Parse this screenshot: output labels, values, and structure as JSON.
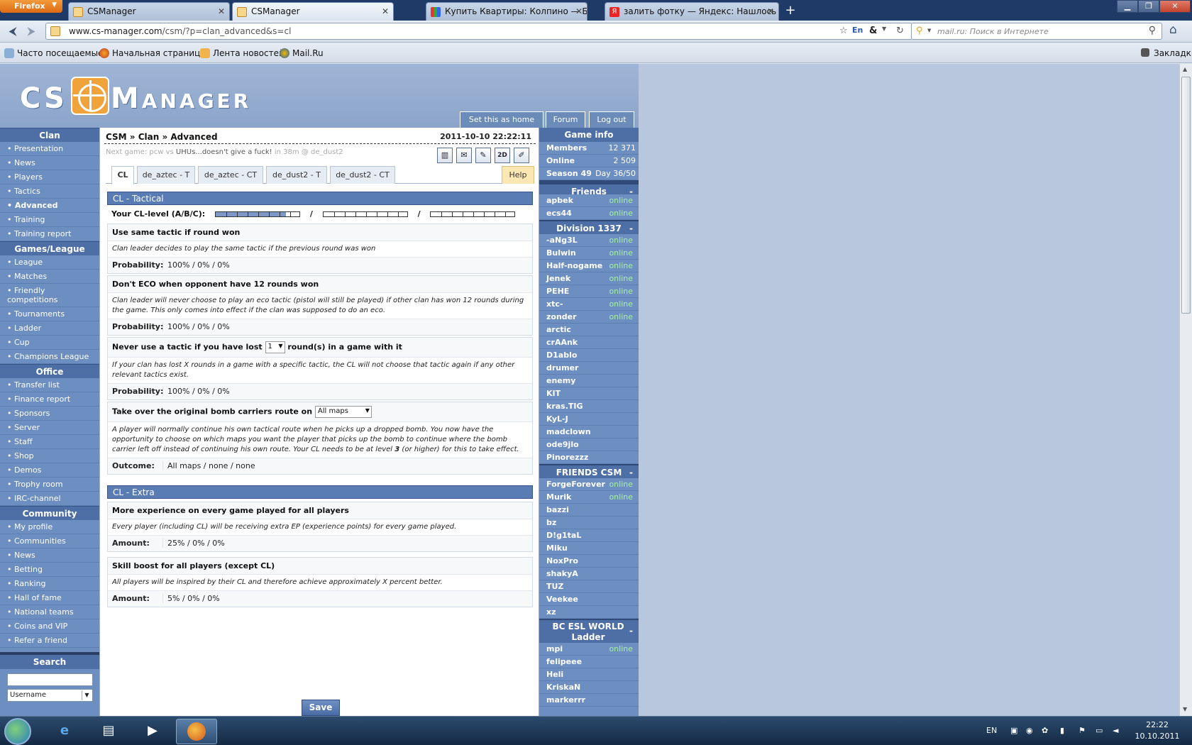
{
  "browser": {
    "menu_label": "Firefox",
    "tabs": [
      {
        "title": "CSManager"
      },
      {
        "title": "CSManager"
      },
      {
        "title": "Купить Квартиры: Колпино — Бесп..."
      },
      {
        "title": "залить фотку — Яндекс: Нашлось 5 ..."
      }
    ],
    "url_host": "www.cs-manager.com",
    "url_path": "/csm/?p=clan_advanced&s=cl",
    "search_placeholder": "mail.ru: Поиск в Интернете",
    "bookmarks": [
      "Часто посещаемые",
      "Начальная страница",
      "Лента новостей",
      "Mail.Ru"
    ],
    "bookmarks_menu": "Закладки"
  },
  "header": {
    "logo_left": "CS",
    "logo_right": "Manager",
    "links": [
      "Set this as home",
      "Forum",
      "Log out"
    ]
  },
  "leftnav": {
    "sections": [
      {
        "title": "Clan",
        "items": [
          "Presentation",
          "News",
          "Players",
          "Tactics",
          "Advanced",
          "Training",
          "Training report"
        ]
      },
      {
        "title": "Games/League",
        "items": [
          "League",
          "Matches",
          "Friendly competitions",
          "Tournaments",
          "Ladder",
          "Cup",
          "Champions League"
        ]
      },
      {
        "title": "Office",
        "items": [
          "Transfer list",
          "Finance report",
          "Sponsors",
          "Server",
          "Staff",
          "Shop",
          "Demos",
          "Trophy room",
          "IRC-channel"
        ]
      },
      {
        "title": "Community",
        "items": [
          "My profile",
          "Communities",
          "News",
          "Betting",
          "Ranking",
          "Hall of fame",
          "National teams",
          "Coins and VIP",
          "Refer a friend"
        ]
      }
    ],
    "search_title": "Search",
    "search_select": "Username"
  },
  "main": {
    "breadcrumb": "CSM » Clan » Advanced",
    "datetime": "2011-10-10 22:22:11",
    "next_game_prefix": "Next game: pcw vs",
    "next_game_opponent": "UHUs...doesn't give a fuck!",
    "next_game_suffix": "in 38m @ de_dust2",
    "tabs": [
      "CL",
      "de_aztec - T",
      "de_aztec - CT",
      "de_dust2 - T",
      "de_dust2 - CT"
    ],
    "help_tab": "Help",
    "section_tactical": "CL - Tactical",
    "cl_level_label": "Your CL-level (A/B/C):",
    "cl_level_fraction": [
      0.84,
      0.0,
      0.0
    ],
    "cl_level_sep": "/",
    "tactic1": {
      "title": "Use same tactic if round won",
      "desc": "Clan leader decides to play the same tactic if the previous round was won",
      "label": "Probability:",
      "value": "100%  /  0%  /  0%"
    },
    "tactic2": {
      "title": "Don't ECO when opponent have 12 rounds won",
      "desc": "Clan leader will never choose to play an eco tactic (pistol will still be played) if other clan has won 12 rounds during the game. This only comes into effect if the clan was supposed to do an eco.",
      "label": "Probability:",
      "value": "100%  /  0%  /  0%"
    },
    "tactic3": {
      "title_before": "Never use a tactic if you have lost",
      "select": "1",
      "title_after": "round(s) in a game with it",
      "desc": "If your clan has lost X rounds in a game with a specific tactic, the CL will not choose that tactic again if any other relevant tactics exist.",
      "label": "Probability:",
      "value": "100%  /  0%  /  0%"
    },
    "tactic4": {
      "title": "Take over the original bomb carriers route on",
      "select": "All maps",
      "desc_before": "A player will normally continue his own tactical route when he picks up a dropped bomb. You now have the opportunity to choose on which maps you want the player that picks up the bomb to continue where the bomb carrier left off instead of continuing his own route. Your CL needs to be at level",
      "desc_level": "3",
      "desc_after": "(or higher) for this to take effect.",
      "label": "Outcome:",
      "value": "All maps  /  none  /  none"
    },
    "section_extra": "CL - Extra",
    "extra1": {
      "title": "More experience on every game played for all players",
      "desc": "Every player (including CL) will be receiving extra EP (experience points) for every game played.",
      "label": "Amount:",
      "value": "25%  /  0%  /  0%"
    },
    "extra2": {
      "title": "Skill boost for all players (except CL)",
      "desc": "All players will be inspired by their CL and therefore achieve approximately X percent better.",
      "label": "Amount:",
      "value": "5%  /  0%  /  0%"
    },
    "save": "Save"
  },
  "rightnav": {
    "game_info_title": "Game info",
    "game_info": [
      {
        "label": "Members",
        "value": "12 371"
      },
      {
        "label": "Online",
        "value": "2 509"
      },
      {
        "label": "Season 49",
        "value": "Day 36/50"
      }
    ],
    "friends_title": "Friends",
    "friends": [
      {
        "name": "apbek",
        "status": "online"
      },
      {
        "name": "ecs44",
        "status": "online"
      }
    ],
    "division_title": "Division 1337",
    "division": [
      {
        "name": "-aNg3L",
        "status": "online"
      },
      {
        "name": "Bulwin",
        "status": "online"
      },
      {
        "name": "Half-nogame",
        "status": "online"
      },
      {
        "name": "Jenek",
        "status": "online"
      },
      {
        "name": "PEHE",
        "status": "online"
      },
      {
        "name": "xtc-",
        "status": "online"
      },
      {
        "name": "zonder",
        "status": "online"
      },
      {
        "name": "arctic",
        "status": ""
      },
      {
        "name": "crAAnk",
        "status": ""
      },
      {
        "name": "D1ablo",
        "status": ""
      },
      {
        "name": "drumer",
        "status": ""
      },
      {
        "name": "enemy",
        "status": ""
      },
      {
        "name": "KIT",
        "status": ""
      },
      {
        "name": "kras.TIG",
        "status": ""
      },
      {
        "name": "KyL-J",
        "status": ""
      },
      {
        "name": "madclown",
        "status": ""
      },
      {
        "name": "ode9jlo",
        "status": ""
      },
      {
        "name": "Pinorezzz",
        "status": ""
      }
    ],
    "friends_csm_title": "FRIENDS CSM",
    "friends_csm": [
      {
        "name": "ForgeForever",
        "status": "online"
      },
      {
        "name": "Murik",
        "status": "online"
      },
      {
        "name": "bazzi",
        "status": ""
      },
      {
        "name": "bz",
        "status": ""
      },
      {
        "name": "D!g1taL",
        "status": ""
      },
      {
        "name": "Miku",
        "status": ""
      },
      {
        "name": "NoxPro",
        "status": ""
      },
      {
        "name": "shakyA",
        "status": ""
      },
      {
        "name": "TUZ",
        "status": ""
      },
      {
        "name": "Veekee",
        "status": ""
      },
      {
        "name": "xz",
        "status": ""
      }
    ],
    "esl_title": "BC ESL WORLD Ladder",
    "esl": [
      {
        "name": "mpi",
        "status": "online"
      },
      {
        "name": "felipeee",
        "status": ""
      },
      {
        "name": "Heli",
        "status": ""
      },
      {
        "name": "KriskaN",
        "status": ""
      },
      {
        "name": "markerrr",
        "status": ""
      }
    ],
    "collapse": "-"
  },
  "taskbar": {
    "lang": "EN",
    "time": "22:22",
    "date": "10.10.2011"
  },
  "colors": {
    "nav_bg": "#6d8ec0",
    "nav_head": "#4d6fa5",
    "section_head": "#5a7cb5",
    "online": "#a6f0a6"
  }
}
